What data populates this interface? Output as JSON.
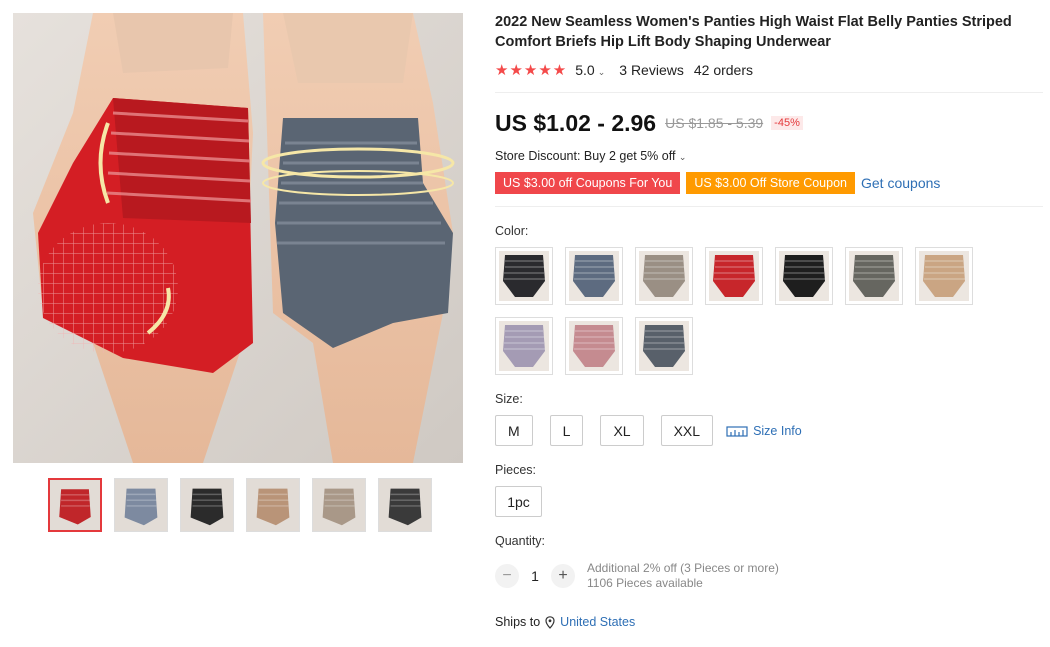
{
  "product": {
    "title": "2022 New Seamless Women's Panties High Waist Flat Belly Panties Striped Comfort Briefs Hip Lift Body Shaping Underwear",
    "rating": {
      "stars": "★★★★★",
      "value": "5.0",
      "reviews": "3 Reviews",
      "orders": "42 orders"
    },
    "price": {
      "current": "US $1.02 - 2.96",
      "original": "US $1.85 - 5.39",
      "discount": "-45%"
    },
    "store_discount": "Store Discount: Buy 2 get 5% off",
    "coupons": {
      "red": "US $3.00 off Coupons For You",
      "orange": "US $3.00 Off Store Coupon",
      "get": "Get coupons"
    }
  },
  "color": {
    "label": "Color:",
    "swatches": [
      {
        "name": "black",
        "color": "#2a2a2e"
      },
      {
        "name": "blue-gray",
        "color": "#5d6b80"
      },
      {
        "name": "beige-gray",
        "color": "#9a8f84"
      },
      {
        "name": "red",
        "color": "#c7262b"
      },
      {
        "name": "black-2",
        "color": "#1e1e1e"
      },
      {
        "name": "gray",
        "color": "#666660"
      },
      {
        "name": "skin",
        "color": "#caa583"
      },
      {
        "name": "lavender",
        "color": "#a49bb4"
      },
      {
        "name": "pink",
        "color": "#c58b90"
      },
      {
        "name": "slate",
        "color": "#58606a"
      }
    ]
  },
  "size": {
    "label": "Size:",
    "options": [
      "M",
      "L",
      "XL",
      "XXL"
    ],
    "info": "Size Info"
  },
  "pieces": {
    "label": "Pieces:",
    "option": "1pc"
  },
  "quantity": {
    "label": "Quantity:",
    "minus": "−",
    "value": "1",
    "plus": "+",
    "note1": "Additional 2% off (3 Pieces or more)",
    "note2": "1106 Pieces available"
  },
  "shipping": {
    "label": "Ships to",
    "country": "United States"
  },
  "gallery": {
    "thumbs": [
      {
        "name": "red-blue-pair",
        "color": "#c0262a"
      },
      {
        "name": "blue-shaping",
        "color": "#7d8aa0"
      },
      {
        "name": "black-detail",
        "color": "#2b2b2b"
      },
      {
        "name": "skin-front",
        "color": "#b99478"
      },
      {
        "name": "closeup",
        "color": "#a99888"
      },
      {
        "name": "dark-detail",
        "color": "#3a3a3a"
      }
    ]
  }
}
